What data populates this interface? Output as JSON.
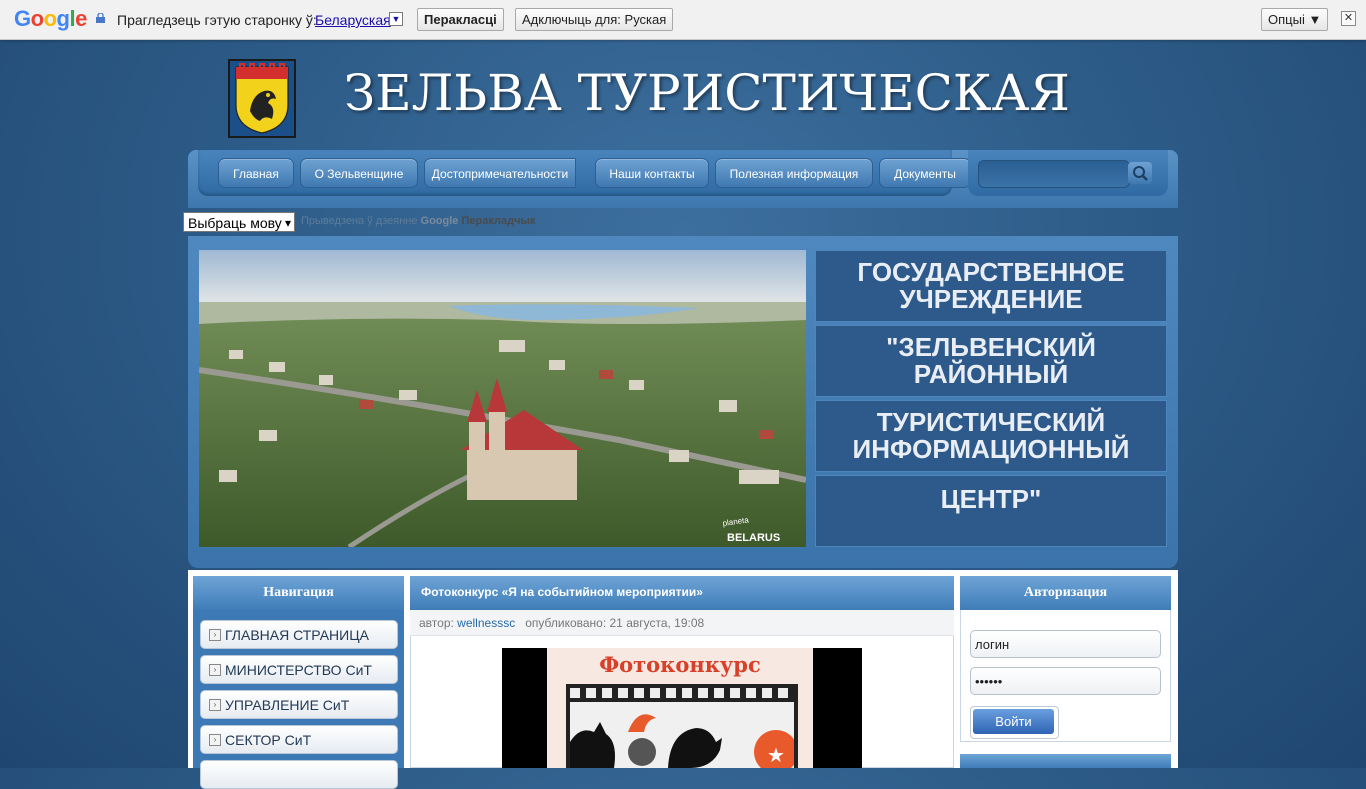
{
  "translate_bar": {
    "logo": "Google",
    "prompt": "Прагледзець гэтую старонку ў:",
    "language": "Беларуская",
    "translate_button": "Перакласці",
    "disable_button": "Адключыць для: Руская",
    "options_button": "Опцыі ▼",
    "close": "✕"
  },
  "header": {
    "title": "ЗЕЛЬВА ТУРИСТИЧЕСКАЯ"
  },
  "nav": {
    "items": [
      "Главная",
      "О Зельвенщине",
      "Достопримечательности",
      "Наши контакты",
      "Полезная информация",
      "Документы"
    ]
  },
  "translate_widget": {
    "select_label": "Выбраць мову",
    "powered_prefix": "Прыведзена ў дзеянне",
    "powered_brand": "Google",
    "powered_service": "Перакладчык"
  },
  "banner": {
    "watermark": "planeta BELARUS",
    "lines": [
      "ГОСУДАРСТВЕННОЕ УЧРЕЖДЕНИЕ",
      "\"ЗЕЛЬВЕНСКИЙ РАЙОННЫЙ",
      "ТУРИСТИЧЕСКИЙ ИНФОРМАЦИОННЫЙ",
      "ЦЕНТР\""
    ]
  },
  "sidebar": {
    "title": "Навигация",
    "items": [
      "ГЛАВНАЯ СТРАНИЦА",
      "МИНИСТЕРСТВО СиТ",
      "УПРАВЛЕНИЕ СиТ",
      "СЕКТОР СиТ"
    ]
  },
  "article": {
    "title": "Фотоконкурс «Я на событийном мероприятии»",
    "author_label": "автор:",
    "author": "wellnesssc",
    "published": "опубликовано: 21 августа, 19:08",
    "poster_title": "Фотоконкурс"
  },
  "auth": {
    "title": "Авторизация",
    "login_value": "логин",
    "password_value": "••••••",
    "submit": "Войти"
  }
}
